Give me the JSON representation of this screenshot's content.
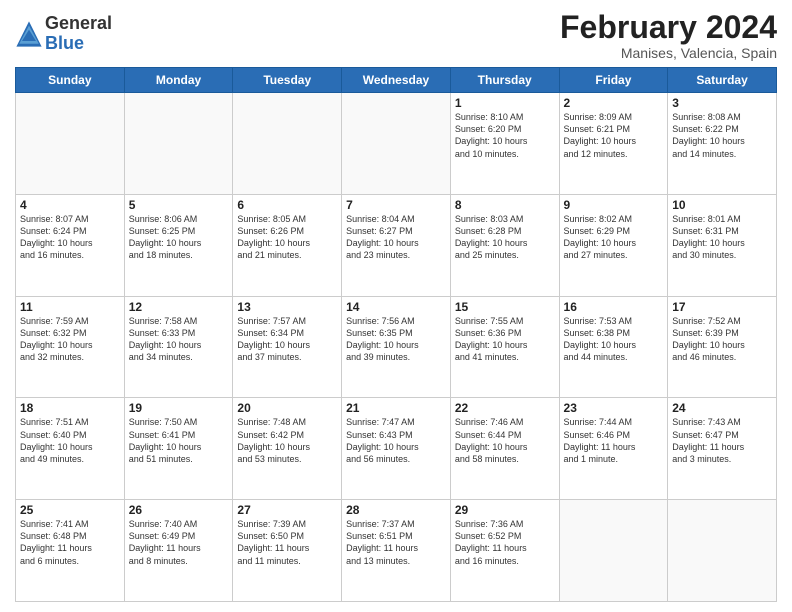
{
  "logo": {
    "general": "General",
    "blue": "Blue"
  },
  "title": {
    "month_year": "February 2024",
    "location": "Manises, Valencia, Spain"
  },
  "weekdays": [
    "Sunday",
    "Monday",
    "Tuesday",
    "Wednesday",
    "Thursday",
    "Friday",
    "Saturday"
  ],
  "weeks": [
    [
      {
        "day": "",
        "info": ""
      },
      {
        "day": "",
        "info": ""
      },
      {
        "day": "",
        "info": ""
      },
      {
        "day": "",
        "info": ""
      },
      {
        "day": "1",
        "info": "Sunrise: 8:10 AM\nSunset: 6:20 PM\nDaylight: 10 hours\nand 10 minutes."
      },
      {
        "day": "2",
        "info": "Sunrise: 8:09 AM\nSunset: 6:21 PM\nDaylight: 10 hours\nand 12 minutes."
      },
      {
        "day": "3",
        "info": "Sunrise: 8:08 AM\nSunset: 6:22 PM\nDaylight: 10 hours\nand 14 minutes."
      }
    ],
    [
      {
        "day": "4",
        "info": "Sunrise: 8:07 AM\nSunset: 6:24 PM\nDaylight: 10 hours\nand 16 minutes."
      },
      {
        "day": "5",
        "info": "Sunrise: 8:06 AM\nSunset: 6:25 PM\nDaylight: 10 hours\nand 18 minutes."
      },
      {
        "day": "6",
        "info": "Sunrise: 8:05 AM\nSunset: 6:26 PM\nDaylight: 10 hours\nand 21 minutes."
      },
      {
        "day": "7",
        "info": "Sunrise: 8:04 AM\nSunset: 6:27 PM\nDaylight: 10 hours\nand 23 minutes."
      },
      {
        "day": "8",
        "info": "Sunrise: 8:03 AM\nSunset: 6:28 PM\nDaylight: 10 hours\nand 25 minutes."
      },
      {
        "day": "9",
        "info": "Sunrise: 8:02 AM\nSunset: 6:29 PM\nDaylight: 10 hours\nand 27 minutes."
      },
      {
        "day": "10",
        "info": "Sunrise: 8:01 AM\nSunset: 6:31 PM\nDaylight: 10 hours\nand 30 minutes."
      }
    ],
    [
      {
        "day": "11",
        "info": "Sunrise: 7:59 AM\nSunset: 6:32 PM\nDaylight: 10 hours\nand 32 minutes."
      },
      {
        "day": "12",
        "info": "Sunrise: 7:58 AM\nSunset: 6:33 PM\nDaylight: 10 hours\nand 34 minutes."
      },
      {
        "day": "13",
        "info": "Sunrise: 7:57 AM\nSunset: 6:34 PM\nDaylight: 10 hours\nand 37 minutes."
      },
      {
        "day": "14",
        "info": "Sunrise: 7:56 AM\nSunset: 6:35 PM\nDaylight: 10 hours\nand 39 minutes."
      },
      {
        "day": "15",
        "info": "Sunrise: 7:55 AM\nSunset: 6:36 PM\nDaylight: 10 hours\nand 41 minutes."
      },
      {
        "day": "16",
        "info": "Sunrise: 7:53 AM\nSunset: 6:38 PM\nDaylight: 10 hours\nand 44 minutes."
      },
      {
        "day": "17",
        "info": "Sunrise: 7:52 AM\nSunset: 6:39 PM\nDaylight: 10 hours\nand 46 minutes."
      }
    ],
    [
      {
        "day": "18",
        "info": "Sunrise: 7:51 AM\nSunset: 6:40 PM\nDaylight: 10 hours\nand 49 minutes."
      },
      {
        "day": "19",
        "info": "Sunrise: 7:50 AM\nSunset: 6:41 PM\nDaylight: 10 hours\nand 51 minutes."
      },
      {
        "day": "20",
        "info": "Sunrise: 7:48 AM\nSunset: 6:42 PM\nDaylight: 10 hours\nand 53 minutes."
      },
      {
        "day": "21",
        "info": "Sunrise: 7:47 AM\nSunset: 6:43 PM\nDaylight: 10 hours\nand 56 minutes."
      },
      {
        "day": "22",
        "info": "Sunrise: 7:46 AM\nSunset: 6:44 PM\nDaylight: 10 hours\nand 58 minutes."
      },
      {
        "day": "23",
        "info": "Sunrise: 7:44 AM\nSunset: 6:46 PM\nDaylight: 11 hours\nand 1 minute."
      },
      {
        "day": "24",
        "info": "Sunrise: 7:43 AM\nSunset: 6:47 PM\nDaylight: 11 hours\nand 3 minutes."
      }
    ],
    [
      {
        "day": "25",
        "info": "Sunrise: 7:41 AM\nSunset: 6:48 PM\nDaylight: 11 hours\nand 6 minutes."
      },
      {
        "day": "26",
        "info": "Sunrise: 7:40 AM\nSunset: 6:49 PM\nDaylight: 11 hours\nand 8 minutes."
      },
      {
        "day": "27",
        "info": "Sunrise: 7:39 AM\nSunset: 6:50 PM\nDaylight: 11 hours\nand 11 minutes."
      },
      {
        "day": "28",
        "info": "Sunrise: 7:37 AM\nSunset: 6:51 PM\nDaylight: 11 hours\nand 13 minutes."
      },
      {
        "day": "29",
        "info": "Sunrise: 7:36 AM\nSunset: 6:52 PM\nDaylight: 11 hours\nand 16 minutes."
      },
      {
        "day": "",
        "info": ""
      },
      {
        "day": "",
        "info": ""
      }
    ]
  ]
}
